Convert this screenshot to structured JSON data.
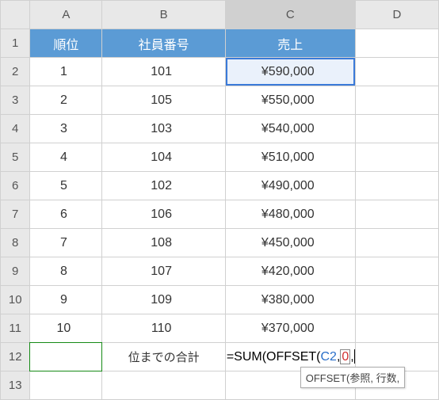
{
  "columns": [
    "A",
    "B",
    "C",
    "D"
  ],
  "rows": [
    1,
    2,
    3,
    4,
    5,
    6,
    7,
    8,
    9,
    10,
    11,
    12,
    13
  ],
  "headers": {
    "A": "順位",
    "B": "社員番号",
    "C": "売上"
  },
  "chart_data": {
    "type": "table",
    "columns": [
      "順位",
      "社員番号",
      "売上"
    ],
    "rows": [
      [
        1,
        101,
        590000
      ],
      [
        2,
        105,
        550000
      ],
      [
        3,
        103,
        540000
      ],
      [
        4,
        104,
        510000
      ],
      [
        5,
        102,
        490000
      ],
      [
        6,
        106,
        480000
      ],
      [
        7,
        108,
        450000
      ],
      [
        8,
        107,
        420000
      ],
      [
        9,
        109,
        380000
      ],
      [
        10,
        110,
        370000
      ]
    ]
  },
  "display": {
    "A": [
      "1",
      "2",
      "3",
      "4",
      "5",
      "6",
      "7",
      "8",
      "9",
      "10"
    ],
    "B": [
      "101",
      "105",
      "103",
      "104",
      "102",
      "106",
      "108",
      "107",
      "109",
      "110"
    ],
    "C": [
      "¥590,000",
      "¥550,000",
      "¥540,000",
      "¥510,000",
      "¥490,000",
      "¥480,000",
      "¥450,000",
      "¥420,000",
      "¥380,000",
      "¥370,000"
    ]
  },
  "row12": {
    "B": "位までの合計",
    "formula_prefix": "=SUM(OFFSET(",
    "formula_ref": "C2",
    "formula_comma": ",",
    "formula_zero": "0",
    "formula_trailing": ","
  },
  "tooltip": "OFFSET(参照, 行数,",
  "active_column": "C",
  "ref_cell": "C2"
}
